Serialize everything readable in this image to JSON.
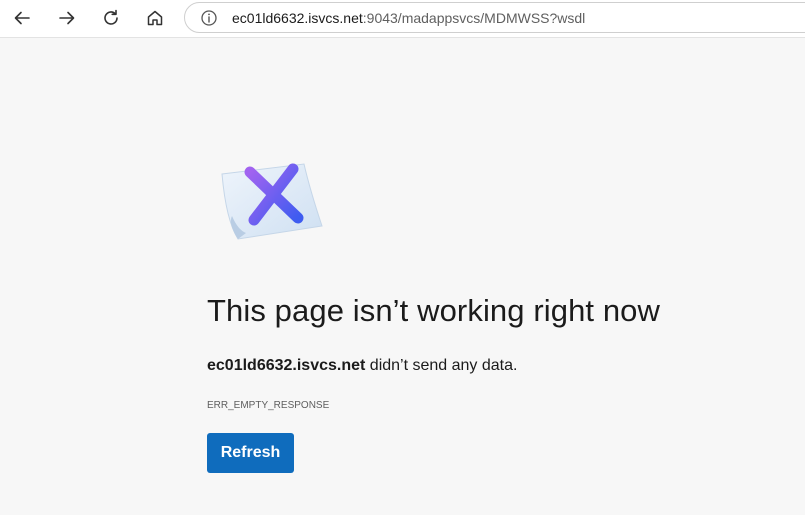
{
  "toolbar": {
    "back_icon": "back-arrow-icon",
    "forward_icon": "forward-arrow-icon",
    "reload_icon": "reload-icon",
    "home_icon": "home-icon"
  },
  "address_bar": {
    "info_icon": "info-icon",
    "host": "ec01ld6632.isvcs.net",
    "path": ":9043/madappsvcs/MDMWSS?wsdl"
  },
  "error": {
    "illustration_icon": "broken-page-x-icon",
    "title": "This page isn’t working right now",
    "host": "ec01ld6632.isvcs.net",
    "message_suffix": " didn’t send any data.",
    "code": "ERR_EMPTY_RESPONSE",
    "refresh_label": "Refresh"
  },
  "colors": {
    "accent": "#0f6cbd",
    "background": "#f7f7f7"
  }
}
